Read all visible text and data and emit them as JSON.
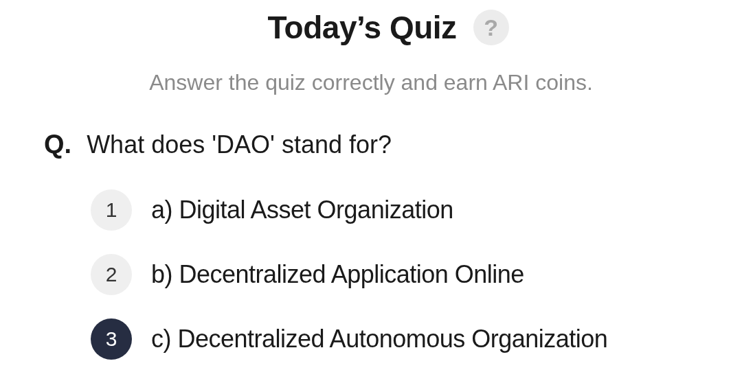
{
  "header": {
    "title": "Today’s Quiz",
    "help": "?",
    "subtitle": "Answer the quiz correctly and earn ARI coins."
  },
  "question": {
    "prefix": "Q.",
    "text": "What does 'DAO' stand for?"
  },
  "options": [
    {
      "number": "1",
      "label": "a) Digital Asset Organization",
      "selected": false
    },
    {
      "number": "2",
      "label": "b) Decentralized Application Online",
      "selected": false
    },
    {
      "number": "3",
      "label": "c) Decentralized Autonomous Organization",
      "selected": true
    }
  ]
}
